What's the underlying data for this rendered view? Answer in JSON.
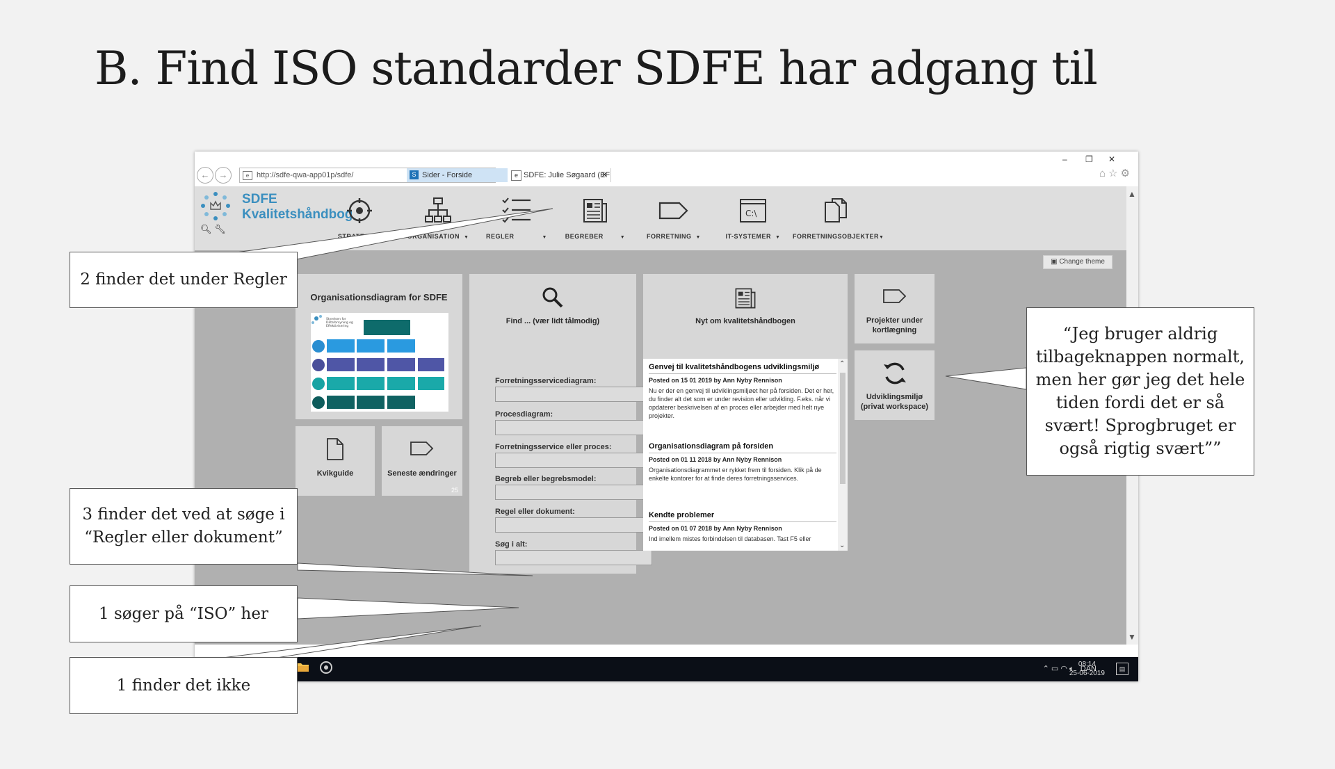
{
  "slide": {
    "title": "B. Find ISO standarder SDFE har adgang til"
  },
  "browser": {
    "address": "http://sdfe-qwa-app01p/sdfe/",
    "tabs": [
      {
        "label": "Sider - Forside",
        "active": true
      },
      {
        "label": "SDFE: Julie Søgaard (EFKM-..."
      }
    ],
    "window_controls": [
      "–",
      "❐",
      "✕"
    ]
  },
  "site": {
    "logo_line1": "SDFE",
    "logo_line2": "Kvalitetshåndbog",
    "nav": [
      {
        "label": "STRATEGI",
        "icon": "target-icon"
      },
      {
        "label": "ORGANISATION",
        "icon": "org-chart-icon"
      },
      {
        "label": "REGLER",
        "icon": "checklist-icon"
      },
      {
        "label": "BEGREBER",
        "icon": "newspaper-icon"
      },
      {
        "label": "FORRETNING",
        "icon": "tag-icon"
      },
      {
        "label": "IT-SYSTEMER",
        "icon": "terminal-icon"
      },
      {
        "label": "FORRETNINGSOBJEKTER",
        "icon": "documents-icon"
      }
    ],
    "change_theme": "Change theme"
  },
  "tiles": {
    "org_title": "Organisationsdiagram for SDFE",
    "org_image_caption": "Styrelsen for Dataforsyning og Effektivisering",
    "kvikguide": "Kvikguide",
    "seneste": "Seneste ændringer",
    "seneste_count": "25",
    "find_title": "Find ... (vær lidt tålmodig)",
    "nyt_title": "Nyt om kvalitetshåndbogen",
    "projekter": "Projekter under kortlægning",
    "udvikling": "Udviklingsmiljø (privat workspace)"
  },
  "find_fields": [
    "Forretningsservicediagram:",
    "Procesdiagram:",
    "Forretningsservice eller proces:",
    "Begreb eller begrebsmodel:",
    "Regel eller dokument:",
    "Søg i alt:"
  ],
  "news": [
    {
      "title": "Genvej til kvalitetshåndbogens udviklingsmiljø",
      "meta": "Posted on 15 01 2019 by Ann Nyby Rennison",
      "body": "Nu er der en genvej til udviklingsmiljøet her på forsiden. Det er her, du finder alt det som er under revision eller udvikling. F.eks. når vi opdaterer beskrivelsen af en proces eller arbejder med helt nye projekter."
    },
    {
      "title": "Organisationsdiagram på forsiden",
      "meta": "Posted on 01 11 2018 by Ann Nyby Rennison",
      "body": "Organisationsdiagrammet er rykket frem til forsiden. Klik på de enkelte kontorer for at finde deres forretningsservices."
    },
    {
      "title": "Kendte problemer",
      "meta": "Posted on 01 07 2018 by Ann Nyby Rennison",
      "body": "Ind imellem mistes forbindelsen til databasen. Tast F5 eller"
    }
  ],
  "taskbar": {
    "lang": "DAN",
    "time": "08:14",
    "date": "25-06-2019"
  },
  "callouts": {
    "regler": "2 finder det under Regler",
    "soege_line1": "3 finder det ved at søge i",
    "soege_line2": "“Regler eller dokument”",
    "iso": "1 søger på “ISO” her",
    "ikke": "1 finder det ikke",
    "quote": "“Jeg bruger aldrig tilbageknappen normalt, men her gør jeg det hele tiden fordi det er så svært! Sprogbruget er også rigtig svært””"
  }
}
